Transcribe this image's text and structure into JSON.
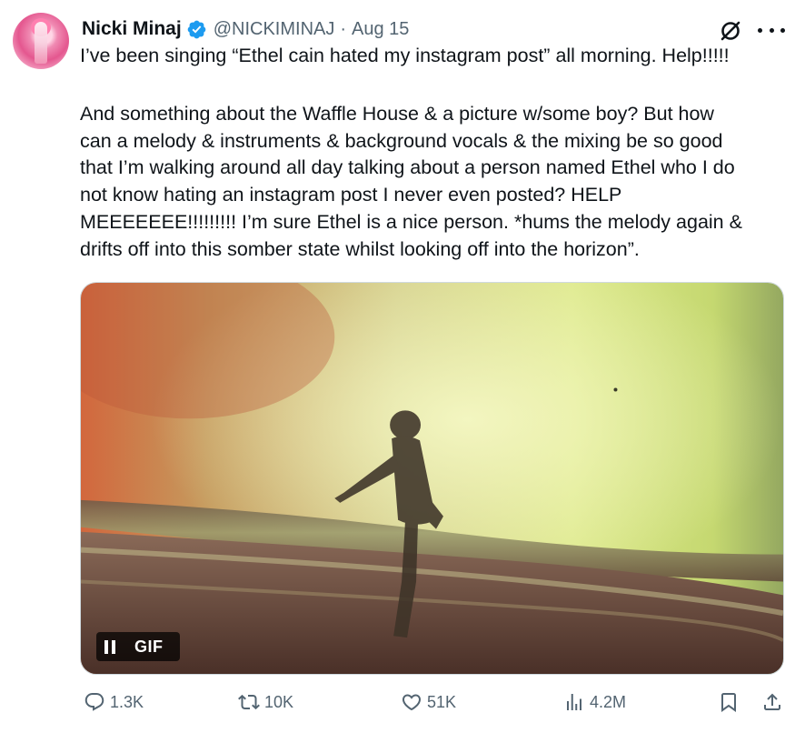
{
  "author": {
    "name": "Nicki Minaj",
    "handle": "@NICKIMINAJ",
    "separator": "·",
    "date": "Aug 15",
    "verified_color": "#1d9bf0",
    "avatar_icon": "profile-photo"
  },
  "tweet": {
    "paragraph_1": "I’ve been singing “Ethel cain hated my instagram post” all morning. Help!!!!!",
    "paragraph_2": "And something about the Waffle House & a picture w/some boy? But how\ncan a melody & instruments & background vocals & the mixing be so good\nthat I’m walking around all day talking about a person named Ethel who I do\nnot know hating an instagram post I never even posted? HELP\nMEEEEEEE!!!!!!!!! I’m sure Ethel is a nice person. *hums the melody again &\ndrifts off into this somber state whilst looking off into the horizon”."
  },
  "media": {
    "type": "gif",
    "badge_label": "GIF",
    "badge_icon": "pause-icon"
  },
  "actions": {
    "replies": "1.3K",
    "retweets": "10K",
    "likes": "51K",
    "views": "4.2M",
    "icons": [
      "reply-icon",
      "retweet-icon",
      "like-icon",
      "views-icon",
      "bookmark-icon",
      "share-icon"
    ]
  },
  "header_icons": [
    "grok-icon",
    "more-icon"
  ],
  "colors": {
    "text": "#0f1419",
    "secondary": "#536471",
    "accent": "#1d9bf0"
  }
}
